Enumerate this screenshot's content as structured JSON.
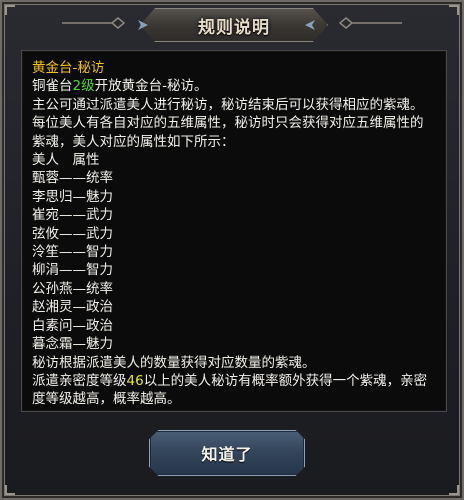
{
  "dialog": {
    "title": "规则说明",
    "button_label": "知道了"
  },
  "rules": {
    "heading": "黄金台-秘访",
    "intro_prefix": "铜雀台",
    "intro_level": "2级",
    "intro_suffix": "开放黄金台-秘访。",
    "para1": "主公可通过派遣美人进行秘访，秘访结束后可以获得相应的紫魂。",
    "para2": "每位美人有各自对应的五维属性，秘访时只会获得对应五维属性的紫魂，美人对应的属性如下所示：",
    "table_header": "美人　属性",
    "beauties": [
      "甄蓉——统率",
      "李思归—魅力",
      "崔宛——武力",
      "弦攸——武力",
      "泠笙——智力",
      "柳涓——智力",
      "公孙燕—统率",
      "赵湘灵—政治",
      "白素问—政治",
      "暮念霜—魅力"
    ],
    "para3": "秘访根据派遣美人的数量获得对应数量的紫魂。",
    "para4_prefix": "派遣亲密度等级",
    "para4_level": "46",
    "para4_suffix": "以上的美人秘访有概率额外获得一个紫魂，亲密度等级越高，概率越高。"
  },
  "colors": {
    "heading": "#f2c21a",
    "level_highlight": "#54d23a",
    "intimacy_highlight": "#e5e53a",
    "text": "#f2f0ea"
  }
}
